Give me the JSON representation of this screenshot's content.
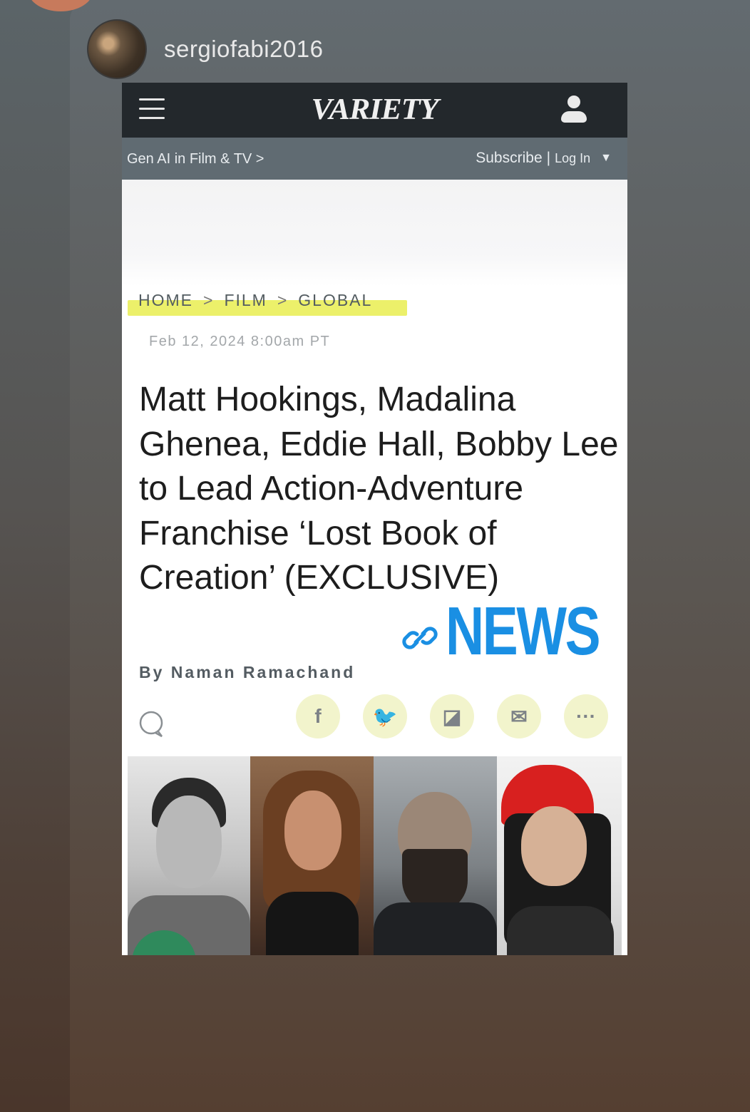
{
  "story": {
    "username": "sergiofabi2016"
  },
  "screenshot": {
    "site": {
      "logo": "VARIETY",
      "sub_nav_link": "Gen AI in Film & TV >",
      "subscribe": "Subscribe",
      "divider": "|",
      "login": "Log In",
      "caret": "▼"
    },
    "article": {
      "breadcrumb": [
        "HOME",
        "FILM",
        "GLOBAL"
      ],
      "breadcrumb_sep": ">",
      "dateline": "Feb 12, 2024 8:00am PT",
      "headline": "Matt Hookings, Madalina Ghenea, Eddie Hall, Bobby Lee to Lead Action-Adventure Franchise ‘Lost Book of Creation’ (EXCLUSIVE)",
      "byline_prefix": "By",
      "author": "Naman Ramachand",
      "share": {
        "facebook": "f",
        "twitter": "🐦",
        "flipboard": "◪",
        "email": "✉",
        "more": "···"
      }
    }
  },
  "sticker": {
    "label": "NEWS",
    "color": "#1a8fe3"
  },
  "colors": {
    "topbar": "#23282c",
    "subbar": "#606b72",
    "highlight": "#ecf06a",
    "share_bg": "#f2f4cc"
  }
}
